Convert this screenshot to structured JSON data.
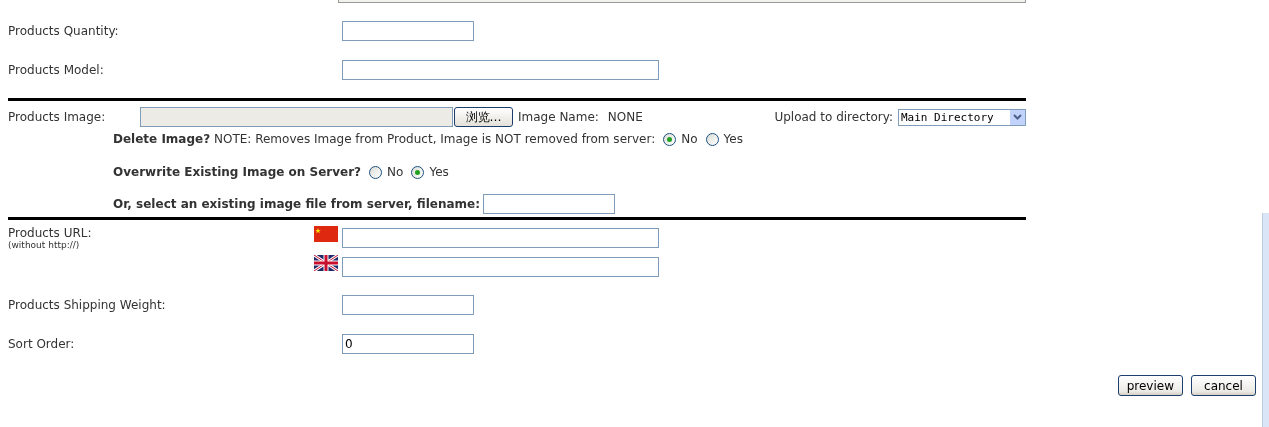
{
  "rows": [
    {
      "kind": "short",
      "label": "Products Quantity:"
    },
    {
      "kind": "long",
      "label": "Products Model:"
    },
    {
      "kind": "rule"
    },
    {
      "kind": "image",
      "label": "Products Image:",
      "browse_button": "浏览…",
      "image_name_label": "Image Name:",
      "image_name": "NONE",
      "upload_label": "Upload to directory:",
      "directory": "Main Directory",
      "delete": {
        "text": "**Delete Image?** NOTE: Removes Image from Product, Image is NOT removed from server:",
        "options": [
          {
            "label": "No",
            "selected": true
          },
          {
            "label": "Yes",
            "selected": false
          }
        ]
      },
      "overwrite": {
        "text": "Overwrite Existing Image on Server?",
        "options": [
          {
            "label": "No",
            "selected": false
          },
          {
            "label": "Yes",
            "selected": true
          }
        ]
      },
      "existing": {
        "text": "Or, select an existing image file from server, filename:"
      }
    },
    {
      "kind": "rule"
    },
    {
      "kind": "url",
      "label": "Products URL:",
      "hint": "(without http://)",
      "languages": [
        {
          "kind": "cn"
        },
        {
          "kind": "gb"
        }
      ]
    },
    {
      "kind": "short",
      "label": "Products Shipping Weight:"
    },
    {
      "kind": "short",
      "label": "Sort Order:",
      "value": "0"
    }
  ],
  "buttons": [
    {
      "label": "preview"
    },
    {
      "label": "cancel"
    }
  ]
}
